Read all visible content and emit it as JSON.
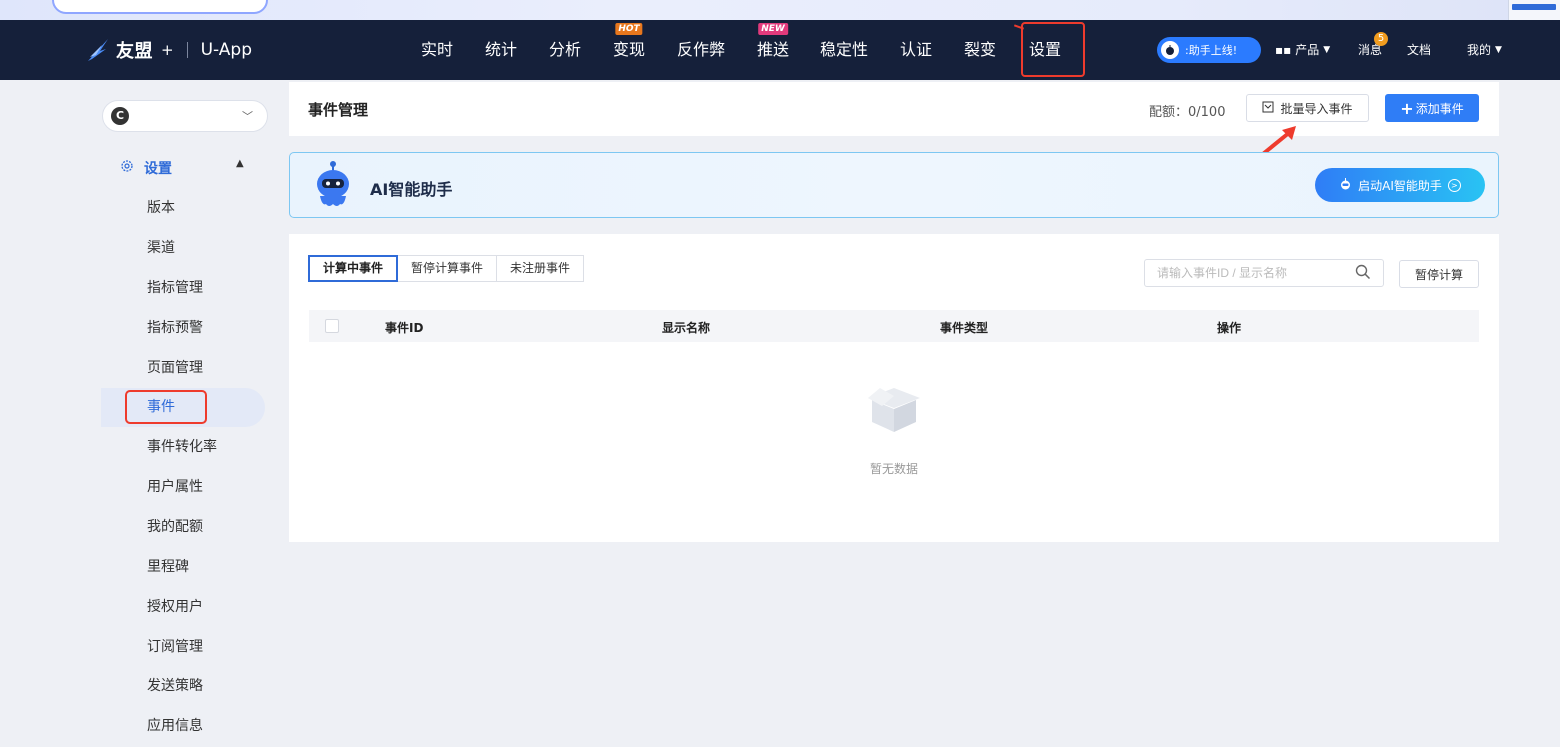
{
  "nav": {
    "brand": "友盟",
    "plus": "+",
    "product": "U-App",
    "items": [
      {
        "label": "实时",
        "badge": ""
      },
      {
        "label": "统计",
        "badge": ""
      },
      {
        "label": "分析",
        "badge": ""
      },
      {
        "label": "变现",
        "badge": "HOT"
      },
      {
        "label": "反作弊",
        "badge": ""
      },
      {
        "label": "推送",
        "badge": "NEW"
      },
      {
        "label": "稳定性",
        "badge": ""
      },
      {
        "label": "认证",
        "badge": ""
      },
      {
        "label": "裂变",
        "badge": ""
      },
      {
        "label": "设置",
        "badge": ""
      }
    ],
    "assistant_label": ":助手上线!",
    "products_label": "产品",
    "messages_label": "消息",
    "messages_count": "5",
    "docs_label": "文档",
    "mine_label": "我的"
  },
  "sidebar": {
    "section_label": "设置",
    "items": [
      {
        "label": "版本"
      },
      {
        "label": "渠道"
      },
      {
        "label": "指标管理"
      },
      {
        "label": "指标预警"
      },
      {
        "label": "页面管理"
      },
      {
        "label": "事件"
      },
      {
        "label": "事件转化率"
      },
      {
        "label": "用户属性"
      },
      {
        "label": "我的配额"
      },
      {
        "label": "里程碑"
      },
      {
        "label": "授权用户"
      },
      {
        "label": "订阅管理"
      },
      {
        "label": "发送策略"
      },
      {
        "label": "应用信息"
      }
    ],
    "active_item": "事件"
  },
  "header": {
    "title": "事件管理",
    "quota": "配额：0/100",
    "import_label": "批量导入事件",
    "add_label": "添加事件",
    "add_plus": "+"
  },
  "ai_banner": {
    "title": "AI智能助手",
    "button_label": "启动AI智能助手"
  },
  "events": {
    "tabs": [
      {
        "label": "计算中事件",
        "active": true
      },
      {
        "label": "暂停计算事件",
        "active": false
      },
      {
        "label": "未注册事件",
        "active": false
      }
    ],
    "search_placeholder": "请输入事件ID / 显示名称",
    "pause_label": "暂停计算",
    "columns": [
      "事件ID",
      "显示名称",
      "事件类型",
      "操作"
    ],
    "empty_text": "暂无数据"
  },
  "colors": {
    "nav_bg": "#15203a",
    "accent": "#2f6bd8",
    "primary_button": "#2f7df6",
    "annotation_red": "#ee3b2d"
  }
}
